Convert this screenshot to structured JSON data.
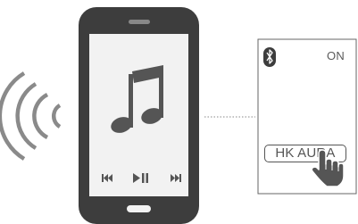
{
  "speaker_panel": {
    "bluetooth_state": "ON",
    "device_name": "HK AURA"
  },
  "icons": {
    "radio_waves": "wireless-signal-icon",
    "music": "music-note-icon",
    "previous": "previous-track-icon",
    "play_pause": "play-pause-icon",
    "next": "next-track-icon",
    "bluetooth": "bluetooth-icon",
    "hand": "pointing-hand-icon"
  },
  "colors": {
    "phone_body": "#3d3d3d",
    "phone_screen": "#f2f2f2",
    "icon_gray": "#555555",
    "waves": "#8a8a8a"
  }
}
